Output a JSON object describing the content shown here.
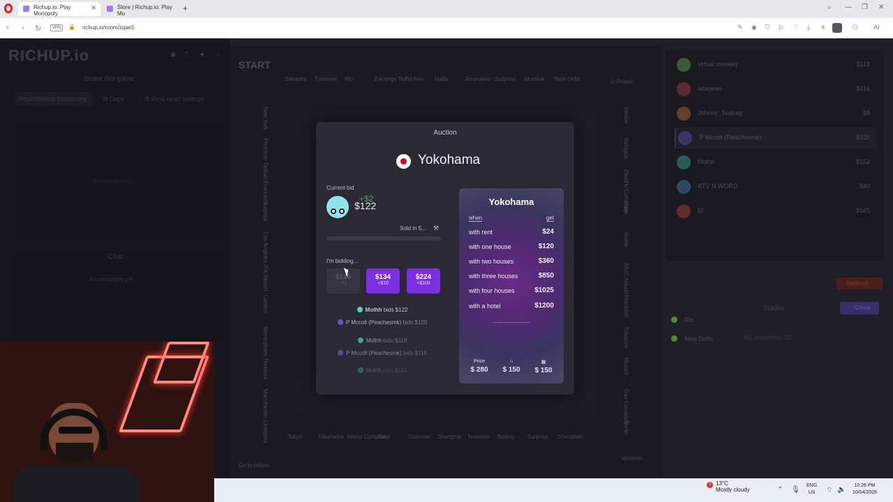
{
  "browser": {
    "tabs": [
      {
        "label": "Richup.io: Play Monopoly"
      },
      {
        "label": "Store | Richup.io: Play Mo"
      }
    ],
    "vpn_badge": "VPN",
    "url": "richup.io/room/zqae5"
  },
  "left_panel": {
    "logo": "RICHUP.io",
    "share_title": "Share this game",
    "share_url": "https://richup.io/room/zq",
    "copy_label": "Copy",
    "room_settings_label": "View room settings",
    "ad_label": "advertisement",
    "chat_title": "Chat",
    "chat_empty": "No messages yet"
  },
  "board": {
    "top_cells": [
      "Salvador",
      "Treasure",
      "Rio",
      "Earnings Tax",
      "Tel Aviv",
      "Haifa",
      "Jerusalem",
      "Surprise",
      "Mumbai",
      "New Delhi"
    ],
    "bottom_cells": [
      "Tokyo",
      "Yokohama",
      "Water Company",
      "Paris",
      "Toulouse",
      "Shanghai",
      "Treasure",
      "Beijing",
      "Surprise",
      "Shenzhen"
    ],
    "left_cells": [
      "New York",
      "Premium Tax",
      "San Francisco",
      "Surprise",
      "Los Angeles",
      "JFK Airport",
      "London",
      "Birmingham",
      "Treasure",
      "Manchester",
      "Liverpool"
    ],
    "right_cells": [
      "Venice",
      "Bologna",
      "Electric Company",
      "Milan",
      "Rome",
      "MUC Airport",
      "Frankfurt",
      "Treasure",
      "Munich",
      "Gas Company",
      "Berlin"
    ],
    "corners": {
      "start": "START",
      "prison": "Go to prison",
      "vacation": "Vacation",
      "jail": "In Prison"
    }
  },
  "players": [
    {
      "name": "virtual monkey",
      "money": "$118",
      "color": "#7fd36a"
    },
    {
      "name": "labejews",
      "money": "$116",
      "color": "#e0465a"
    },
    {
      "name": "Johnny_Teabag",
      "money": "$8",
      "color": "#f08a4a"
    },
    {
      "name": "P Mccoll (Peachesmk)",
      "money": "$320",
      "color": "#7a5ae0"
    },
    {
      "name": "Mothh",
      "money": "$152",
      "color": "#4ad7c4"
    },
    {
      "name": "KTV N WORD",
      "money": "$40",
      "color": "#58a0e0"
    },
    {
      "name": "El",
      "money": "$165",
      "color": "#e04a4a"
    }
  ],
  "actions": {
    "bankrupt": "Bankrupt",
    "trades": "Trades",
    "create": "Create"
  },
  "my_properties": {
    "title": "My properties (2)",
    "items": [
      {
        "name": "Rio",
        "color": "#9ad04a"
      },
      {
        "name": "New Delhi",
        "color": "#9ad04a"
      }
    ]
  },
  "auction": {
    "title": "Auction",
    "property": "Yokohama",
    "current_bid_label": "Current bid",
    "current_bid": "$122",
    "bid_increment": "+$2",
    "sold_in": "Sold in 5...",
    "progress": 0.0,
    "bidding_label": "I'm bidding...",
    "bid_buttons": [
      {
        "amount": "$126",
        "inc": "+$2",
        "enabled": false
      },
      {
        "amount": "$134",
        "inc": "+$10",
        "enabled": true
      },
      {
        "amount": "$224",
        "inc": "+$100",
        "enabled": true
      }
    ],
    "log": [
      {
        "name": "Mothh",
        "text": "bids $122"
      },
      {
        "name": "P Mccoll (Peachesmk)",
        "text": "bids $120"
      },
      {
        "name": "Mothh",
        "text": "bids $118"
      },
      {
        "name": "P Mccoll (Peachesmk)",
        "text": "bids $116"
      },
      {
        "name": "Mothh",
        "text": "bids $114"
      }
    ]
  },
  "card": {
    "title": "Yokohama",
    "when": "when",
    "get": "get",
    "rows": [
      {
        "label": "with rent",
        "value": "$24"
      },
      {
        "label": "with one house",
        "value": "$120"
      },
      {
        "label": "with two houses",
        "value": "$360"
      },
      {
        "label": "with three houses",
        "value": "$850"
      },
      {
        "label": "with four houses",
        "value": "$1025"
      },
      {
        "label": "with a hotel",
        "value": "$1200"
      }
    ],
    "price_label": "Price",
    "price": "$ 280",
    "house_cost": "$ 150",
    "hotel_cost": "$ 150"
  },
  "taskbar": {
    "notif_count": "3",
    "temp": "13°C",
    "weather": "Mostly cloudy",
    "lang1": "ENG",
    "lang2": "US",
    "time": "10:26 PM",
    "date": "10/04/2026"
  }
}
